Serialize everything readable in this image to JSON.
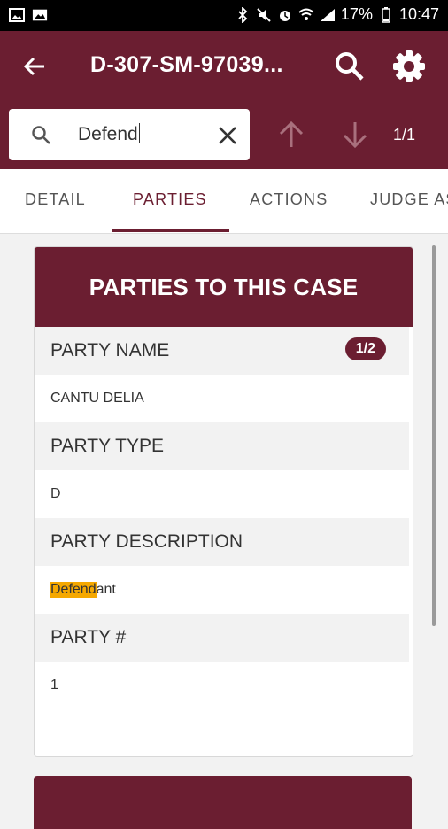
{
  "status_bar": {
    "battery_percent": "17%",
    "time": "10:47"
  },
  "app_bar": {
    "title": "D-307-SM-97039..."
  },
  "find_bar": {
    "query": "Defend",
    "match_count": "1/1"
  },
  "tabs": [
    {
      "label": "DETAIL"
    },
    {
      "label": "PARTIES",
      "active": true
    },
    {
      "label": "ACTIONS"
    },
    {
      "label": "JUDGE ASSIGNMENT"
    }
  ],
  "card": {
    "title": "PARTIES TO THIS CASE",
    "badge": "1/2",
    "fields": [
      {
        "label": "PARTY NAME",
        "value": "CANTU DELIA"
      },
      {
        "label": "PARTY TYPE",
        "value": "D"
      },
      {
        "label": "PARTY DESCRIPTION",
        "value_highlight": "Defend",
        "value_rest": "ant"
      },
      {
        "label": "PARTY #",
        "value": "1"
      }
    ]
  },
  "colors": {
    "brand": "#6b1e31",
    "highlight": "#f5a800"
  }
}
